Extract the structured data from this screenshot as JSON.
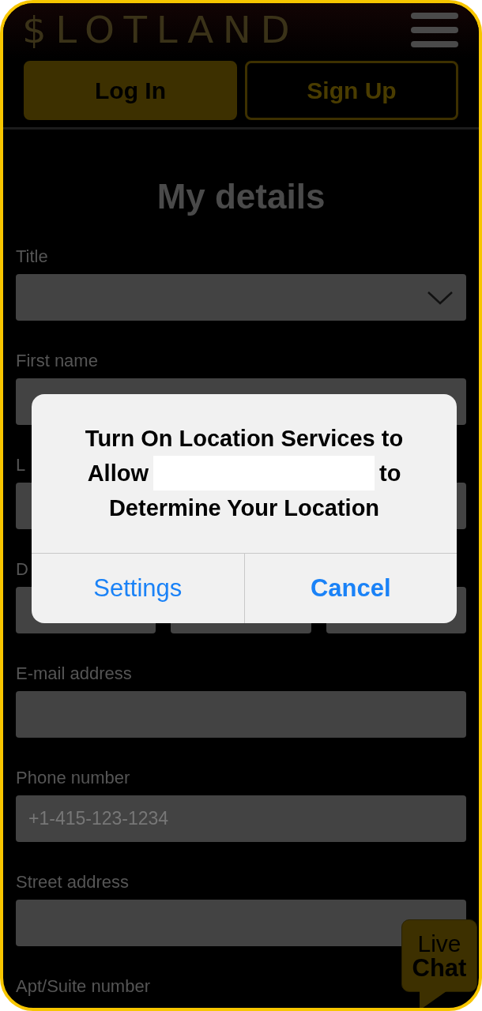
{
  "header": {
    "logo": "$LOTLAND",
    "buttons": [
      {
        "label": "Log In",
        "kind": "primary"
      },
      {
        "label": "Sign Up",
        "kind": "outline"
      }
    ]
  },
  "heading": "My details",
  "fields": [
    {
      "label": "Title",
      "kind": "select"
    },
    {
      "label": "First name",
      "kind": "text"
    },
    {
      "label": "L",
      "kind": "text"
    },
    {
      "label": "D",
      "kind": "date"
    },
    {
      "label": "E-mail address",
      "kind": "text"
    },
    {
      "label": "Phone number",
      "kind": "text",
      "placeholder": "+1-415-123-1234"
    },
    {
      "label": "Street address",
      "kind": "text"
    },
    {
      "label": "Apt/Suite number",
      "kind": "label"
    }
  ],
  "dialog": {
    "message": [
      [
        "Turn On Location Services to"
      ],
      [
        "Allow",
        "to"
      ],
      [
        "Determine Your Location"
      ]
    ],
    "buttons": [
      {
        "label": "Settings",
        "bold": false
      },
      {
        "label": "Cancel",
        "bold": true
      }
    ]
  },
  "live_chat": {
    "lines": [
      "Live",
      "Chat"
    ]
  }
}
